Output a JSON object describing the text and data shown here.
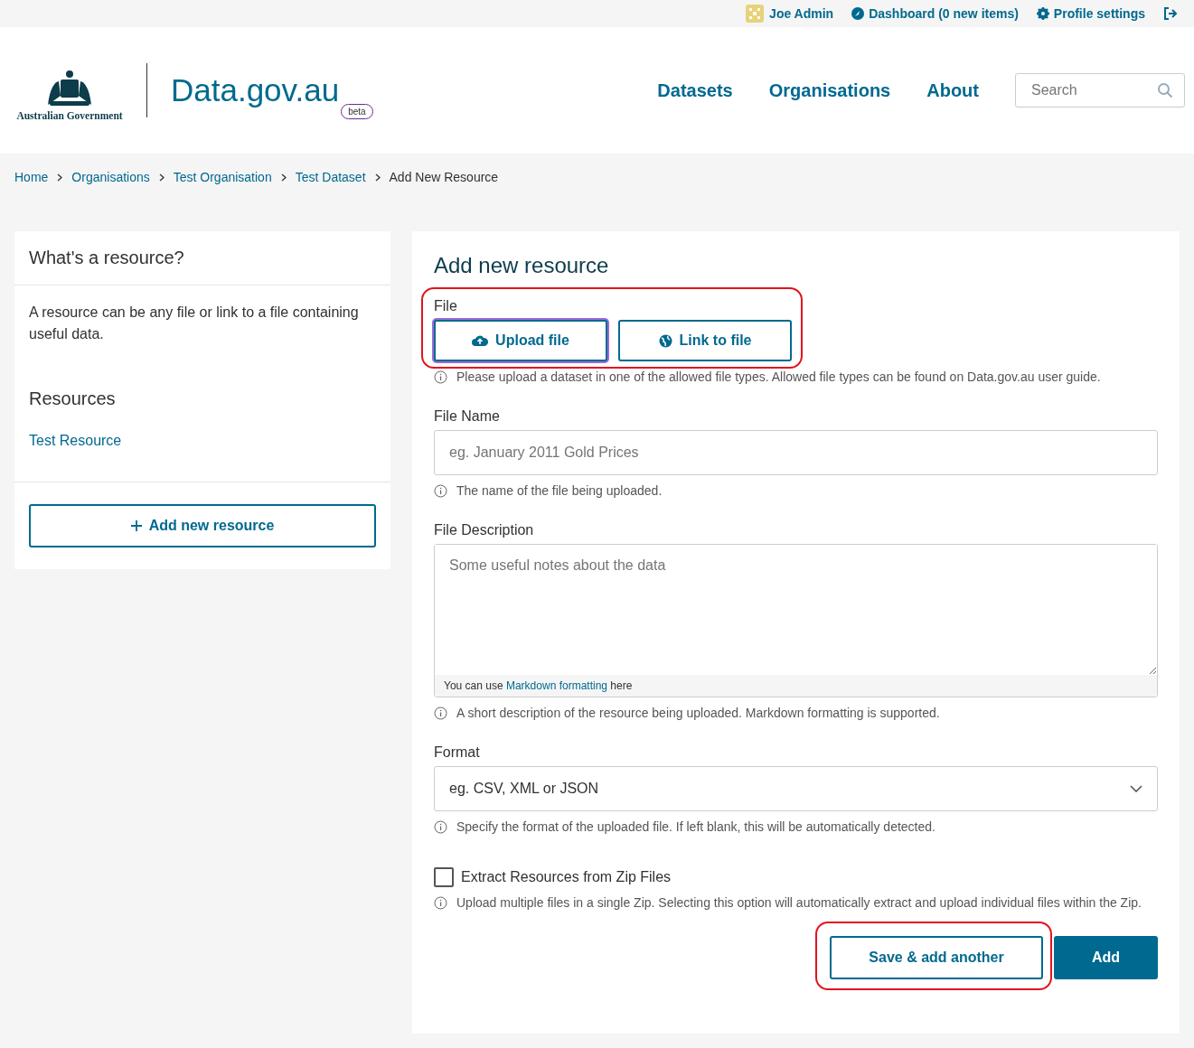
{
  "top_bar": {
    "user": "Joe Admin",
    "dashboard": "Dashboard (0 new items)",
    "profile": "Profile settings"
  },
  "header": {
    "gov_label": "Australian Government",
    "site_title": "Data.gov.au",
    "badge": "beta",
    "nav": [
      "Datasets",
      "Organisations",
      "About"
    ],
    "search": {
      "placeholder": "Search"
    }
  },
  "breadcrumbs": [
    {
      "label": "Home",
      "link": true
    },
    {
      "label": "Organisations",
      "link": true
    },
    {
      "label": "Test Organisation",
      "link": true
    },
    {
      "label": "Test Dataset",
      "link": true
    },
    {
      "label": "Add New Resource",
      "link": false
    }
  ],
  "sidebar": {
    "title": "What's a resource?",
    "text": "A resource can be any file or link to a file containing useful data.",
    "resources_title": "Resources",
    "resources": [
      "Test Resource"
    ],
    "add_button": "Add new resource"
  },
  "form": {
    "title": "Add new resource",
    "file": {
      "label": "File",
      "highlighted": true,
      "options": [
        {
          "label": "Upload file",
          "kind": "upload",
          "selected": true
        },
        {
          "label": "Link to file",
          "kind": "link",
          "selected": false
        }
      ],
      "help": "Please upload a dataset in one of the allowed file types. Allowed file types can be found on Data.gov.au user guide."
    },
    "name": {
      "label": "File Name",
      "placeholder": "eg. January 2011 Gold Prices",
      "help": "The name of the file being uploaded."
    },
    "description": {
      "label": "File Description",
      "placeholder": "Some useful notes about the data",
      "hint_prefix": "You can use",
      "hint_link": "Markdown formatting",
      "hint_suffix": "here",
      "help": "A short description of the resource being uploaded. Markdown formatting is supported."
    },
    "format": {
      "label": "Format",
      "placeholder": "eg. CSV, XML or JSON",
      "help": "Specify the format of the uploaded file. If left blank, this will be automatically detected."
    },
    "extract": {
      "label": "Extract Resources from Zip Files",
      "checked": false,
      "help": "Upload multiple files in a single Zip. Selecting this option will automatically extract and upload individual files within the Zip."
    },
    "buttons": [
      {
        "label": "Save & add another",
        "kind": "secondary",
        "highlighted": true
      },
      {
        "label": "Add",
        "kind": "primary",
        "highlighted": false
      }
    ]
  }
}
